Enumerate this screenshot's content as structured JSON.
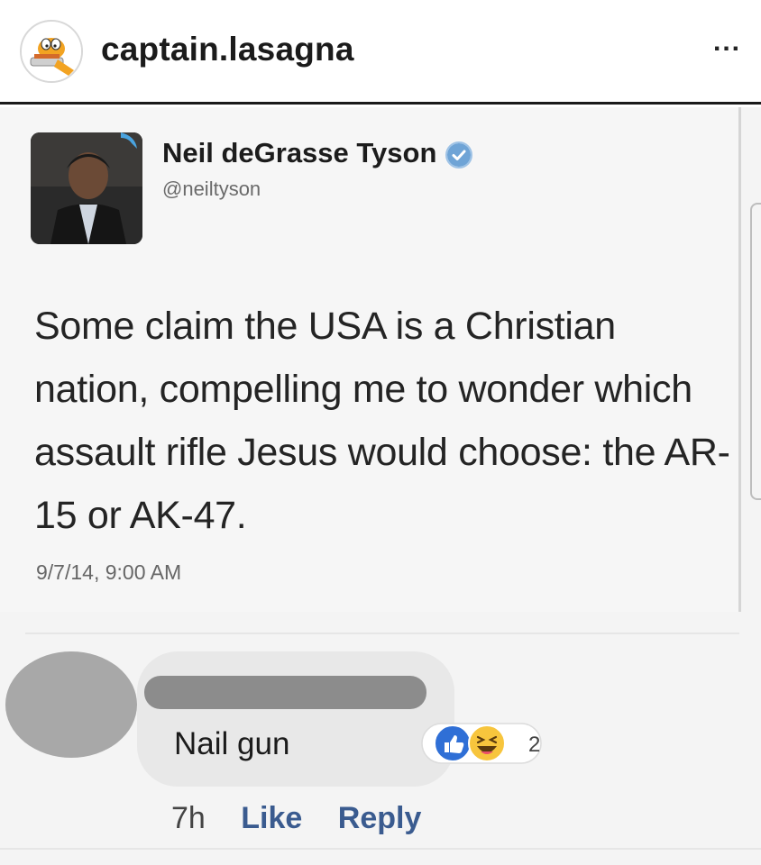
{
  "instagram": {
    "username": "captain.lasagna",
    "more_icon": "more-horizontal-icon",
    "more_label": "..."
  },
  "tweet": {
    "author_name": "Neil deGrasse Tyson",
    "handle": "@neiltyson",
    "verified_icon": "verified-badge-icon",
    "text": "Some claim the USA is a Christian nation, compelling me to wonder which assault rifle Jesus would choose: the AR-15 or AK-47.",
    "timestamp": "9/7/14, 9:00 AM"
  },
  "comment": {
    "text": "Nail gun",
    "reaction_icons": [
      "like-reaction-icon",
      "haha-reaction-icon"
    ],
    "reaction_count": "2",
    "time": "7h",
    "like_label": "Like",
    "reply_label": "Reply"
  },
  "colors": {
    "fb_link": "#3a5b8f",
    "verified_blue": "#1da1f2",
    "like_blue": "#1877f2"
  }
}
